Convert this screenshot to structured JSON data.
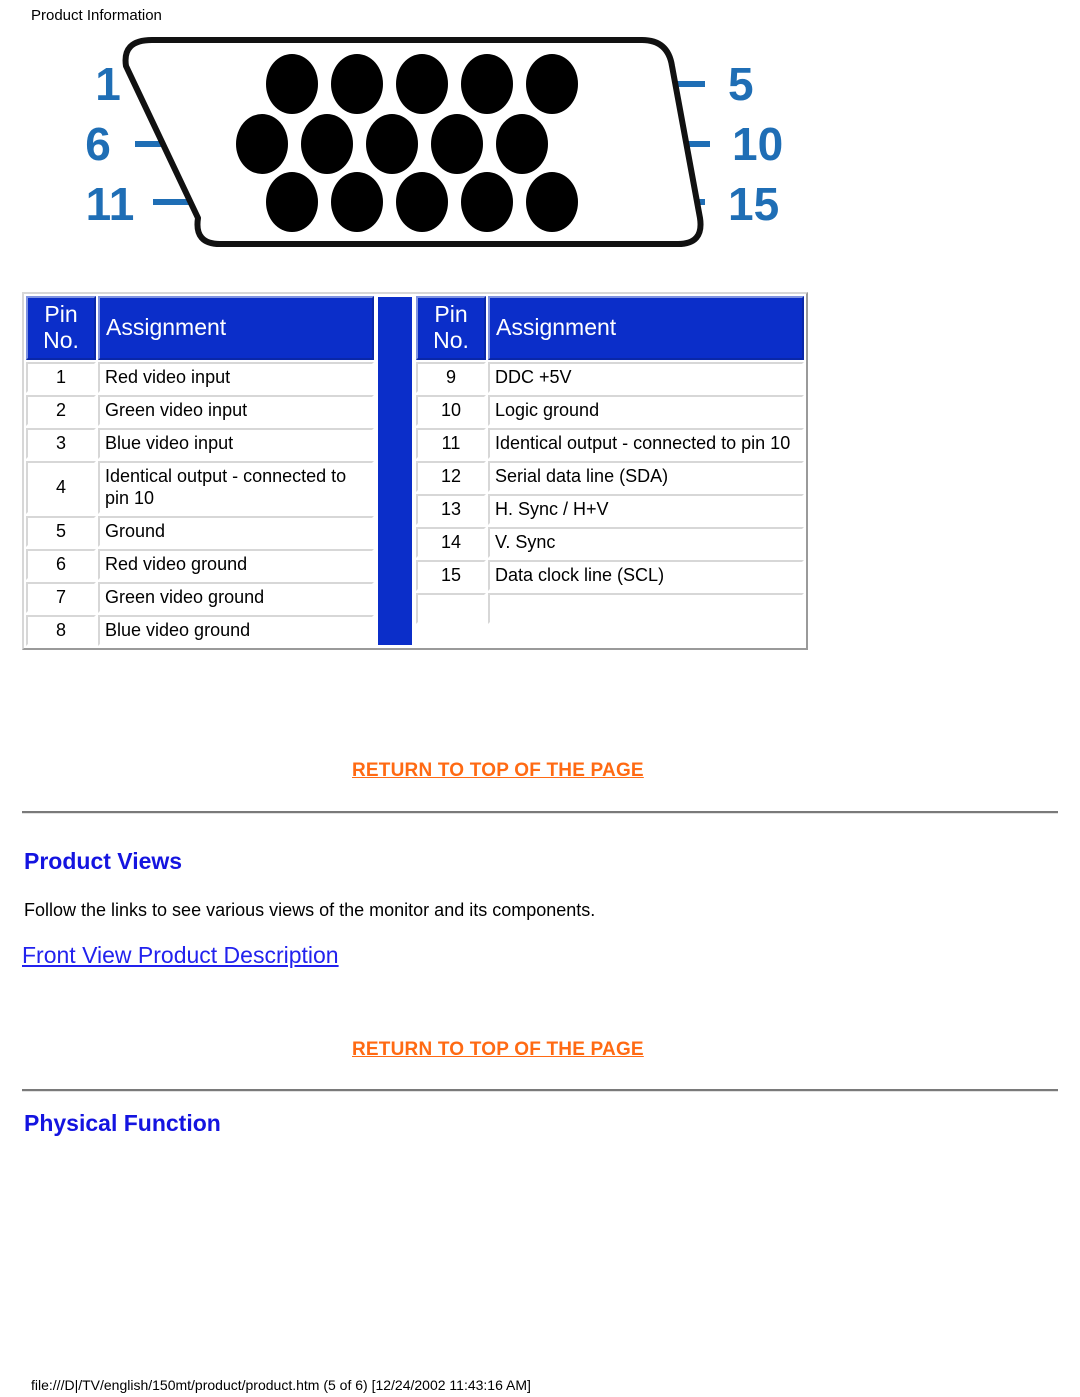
{
  "page": {
    "header_label": "Product Information",
    "footer_text": "file:///D|/TV/english/150mt/product/product.htm (5 of 6) [12/24/2002 11:43:16 AM]"
  },
  "colors": {
    "table_header_blue": "#0b2ec9",
    "pin_label_blue": "#1f6eb5",
    "return_link_orange": "#ff6a13",
    "heading_blue": "#1414e0",
    "link_blue": "#2222ee",
    "pin_black": "#000000"
  },
  "connector_diagram": {
    "alt": "15-pin D-sub VGA connector pinout diagram",
    "row_labels": [
      {
        "left": "1",
        "right": "5"
      },
      {
        "left": "6",
        "right": "10"
      },
      {
        "left": "11",
        "right": "15"
      }
    ],
    "rows": 3,
    "pins_per_row": 5,
    "total_pins": 15
  },
  "pin_table_left": {
    "headers": {
      "pin_no": "Pin No.",
      "pin_no_line1": "Pin",
      "pin_no_line2": "No.",
      "assignment": "Assignment"
    },
    "rows": [
      {
        "pin": "1",
        "assignment": "Red video input"
      },
      {
        "pin": "2",
        "assignment": "Green video input"
      },
      {
        "pin": "3",
        "assignment": "Blue video input"
      },
      {
        "pin": "4",
        "assignment": "Identical output - connected to pin 10"
      },
      {
        "pin": "5",
        "assignment": "Ground"
      },
      {
        "pin": "6",
        "assignment": "Red video ground"
      },
      {
        "pin": "7",
        "assignment": "Green video ground"
      },
      {
        "pin": "8",
        "assignment": "Blue video ground"
      }
    ]
  },
  "pin_table_right": {
    "headers": {
      "pin_no": "Pin No.",
      "pin_no_line1": "Pin",
      "pin_no_line2": "No.",
      "assignment": "Assignment"
    },
    "rows": [
      {
        "pin": "9",
        "assignment": "DDC +5V"
      },
      {
        "pin": "10",
        "assignment": "Logic ground"
      },
      {
        "pin": "11",
        "assignment": "Identical output - connected to pin 10"
      },
      {
        "pin": "12",
        "assignment": "Serial data line (SDA)"
      },
      {
        "pin": "13",
        "assignment": "H. Sync / H+V"
      },
      {
        "pin": "14",
        "assignment": "V. Sync"
      },
      {
        "pin": "15",
        "assignment": "Data clock line (SCL)"
      },
      {
        "pin": "",
        "assignment": ""
      }
    ]
  },
  "links": {
    "return_to_top_1": "RETURN TO TOP OF THE PAGE",
    "return_to_top_2": "RETURN TO TOP OF THE PAGE",
    "front_view_product_description": "Front View Product Description"
  },
  "sections": {
    "product_views": {
      "heading": "Product Views",
      "body": "Follow the links to see various views of the monitor and its components."
    },
    "physical_function": {
      "heading": "Physical Function"
    }
  }
}
